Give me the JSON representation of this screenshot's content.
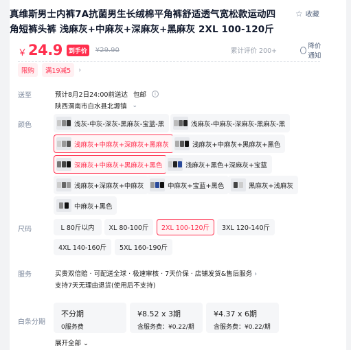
{
  "product": {
    "title": "真维斯男士内裤7A抗菌男生长绒棉平角裤舒适透气宽松款运动四角短裤头裤 浅麻灰+中麻灰+深麻灰+黑麻灰 2XL 100-120斤",
    "favorite_label": "收藏"
  },
  "price": {
    "currency": "￥",
    "current": "24.9",
    "badge": "到手价",
    "original": "¥29.90",
    "reviews": "累计评价 200+",
    "low_price_alert": "降价通知"
  },
  "promos": [
    "限购",
    "满19减5"
  ],
  "shipping": {
    "label": "送至",
    "estimate": "预计8月2日24:00前送达",
    "postage": "包邮",
    "address": "陕西渭南市白水县北塬镇"
  },
  "color": {
    "label": "颜色",
    "options": [
      {
        "text": "浅灰-中灰-深灰-黑麻灰-宝蓝-黑",
        "selected": false
      },
      {
        "text": "浅麻灰-中麻灰-深麻灰-黑麻灰-黑",
        "selected": false
      },
      {
        "text": "浅麻灰+中麻灰+深麻灰+黑麻灰",
        "selected": true
      },
      {
        "text": "浅麻灰+中麻灰+黑麻灰+黑色",
        "selected": false
      },
      {
        "text": "深麻灰+中麻灰+黑麻灰+黑色",
        "selected": true
      },
      {
        "text": "浅麻灰+黑色+深麻灰+宝蓝",
        "selected": false
      },
      {
        "text": "浅麻灰+深麻灰+中麻灰",
        "selected": false
      },
      {
        "text": "中麻灰+宝蓝+黑色",
        "selected": false
      },
      {
        "text": "黑麻灰+浅麻灰",
        "selected": false
      },
      {
        "text": "中麻灰+黑色",
        "selected": false
      }
    ]
  },
  "size": {
    "label": "尺码",
    "options": [
      {
        "text": "L 80斤以内",
        "selected": false
      },
      {
        "text": "XL 80-100斤",
        "selected": false
      },
      {
        "text": "2XL 100-120斤",
        "selected": true
      },
      {
        "text": "3XL 120-140斤",
        "selected": false
      },
      {
        "text": "4XL 140-160斤",
        "selected": false
      },
      {
        "text": "5XL 160-190斤",
        "selected": false
      }
    ]
  },
  "service": {
    "label": "服务",
    "line1": "买贵双倍赔 · 可配送全球 · 极速审核 · 7天价保 · 店铺发货&售后服务",
    "line2": "支持7天无理由退货(使用后不支持)"
  },
  "installment": {
    "label": "白条分期",
    "options": [
      {
        "title": "不分期",
        "fee": "0服务费"
      },
      {
        "title": "¥8.52 x 3期",
        "fee": "含服务费：¥0.22/期"
      },
      {
        "title": "¥4.37 x 6期",
        "fee": "含服务费：¥0.22/期"
      }
    ],
    "expand": "展开全部"
  }
}
